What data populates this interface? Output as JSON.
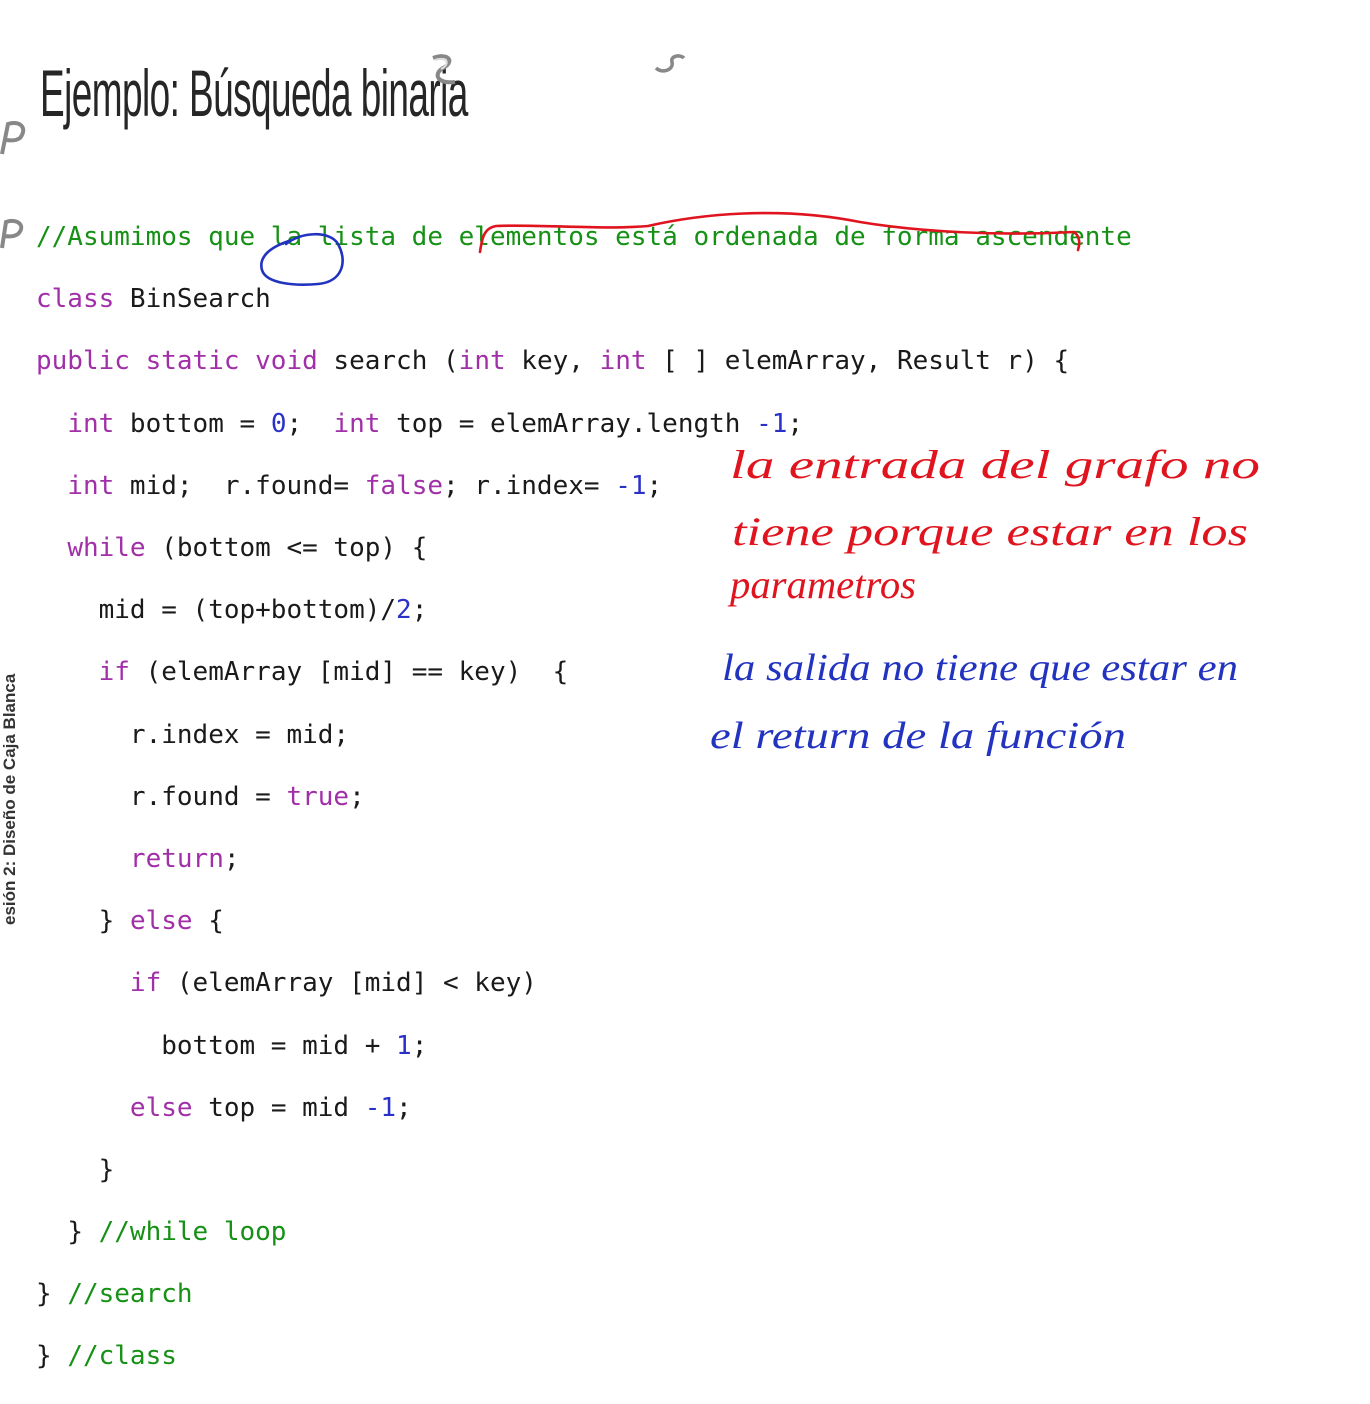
{
  "slide": {
    "title": "Ejemplo: Búsqueda binaria",
    "side_label": "esión 2: Diseño de Caja Blanca"
  },
  "code": {
    "line1": "//Asumimos que la lista de elementos está ordenada de forma ascendente",
    "line2_kw": "class",
    "line2_rest": " BinSearch",
    "line3_kw1": "public static",
    "line3_kw2": "void",
    "line3_a": " search (",
    "line3_kw3": "int",
    "line3_b": " key, ",
    "line3_kw4": "int",
    "line3_c": " [ ] elemArray, Result r) {",
    "line4_kw1": "int",
    "line4_a": " bottom = ",
    "line4_n1": "0",
    "line4_b": ";  ",
    "line4_kw2": "int",
    "line4_c": " top = elemArray.length ",
    "line4_n2": "-1",
    "line4_d": ";",
    "line5_kw1": "int",
    "line5_a": " mid;  r.found= ",
    "line5_kw2": "false",
    "line5_b": "; r.index= ",
    "line5_n": "-1",
    "line5_c": ";",
    "line6_kw": "while",
    "line6_a": " (bottom <= top) {",
    "line7_a": "mid = (top+bottom)/",
    "line7_n": "2",
    "line7_b": ";",
    "line8_kw": "if",
    "line8_a": " (elemArray [mid] == key)  {",
    "line9": "r.index = mid;",
    "line10_a": "r.found = ",
    "line10_kw": "true",
    "line10_b": ";",
    "line11_kw": "return",
    "line11_a": ";",
    "line12_a": "} ",
    "line12_kw": "else",
    "line12_b": " {",
    "line13_kw": "if",
    "line13_a": " (elemArray [mid] < key)",
    "line14_a": "bottom = mid + ",
    "line14_n": "1",
    "line14_b": ";",
    "line15_kw": "else",
    "line15_a": " top = mid ",
    "line15_n": "-1",
    "line15_b": ";",
    "line16": "}",
    "line17_a": "} ",
    "line17_cm": "//while loop",
    "line18_a": "} ",
    "line18_cm": "//search",
    "line19_a": "} ",
    "line19_cm": "//class"
  },
  "annotations": {
    "red_line1": "la entrada del grafo no",
    "red_line2": "tiene porque estar en los",
    "red_line3": "parametros",
    "blue_line1": "la salida no tiene que estar en",
    "blue_line2": "el return de la función"
  },
  "colors": {
    "keyword": "#a12fa8",
    "comment": "#169116",
    "number": "#2a31c9",
    "red_ink": "#e0141e",
    "blue_ink": "#2233c0"
  }
}
